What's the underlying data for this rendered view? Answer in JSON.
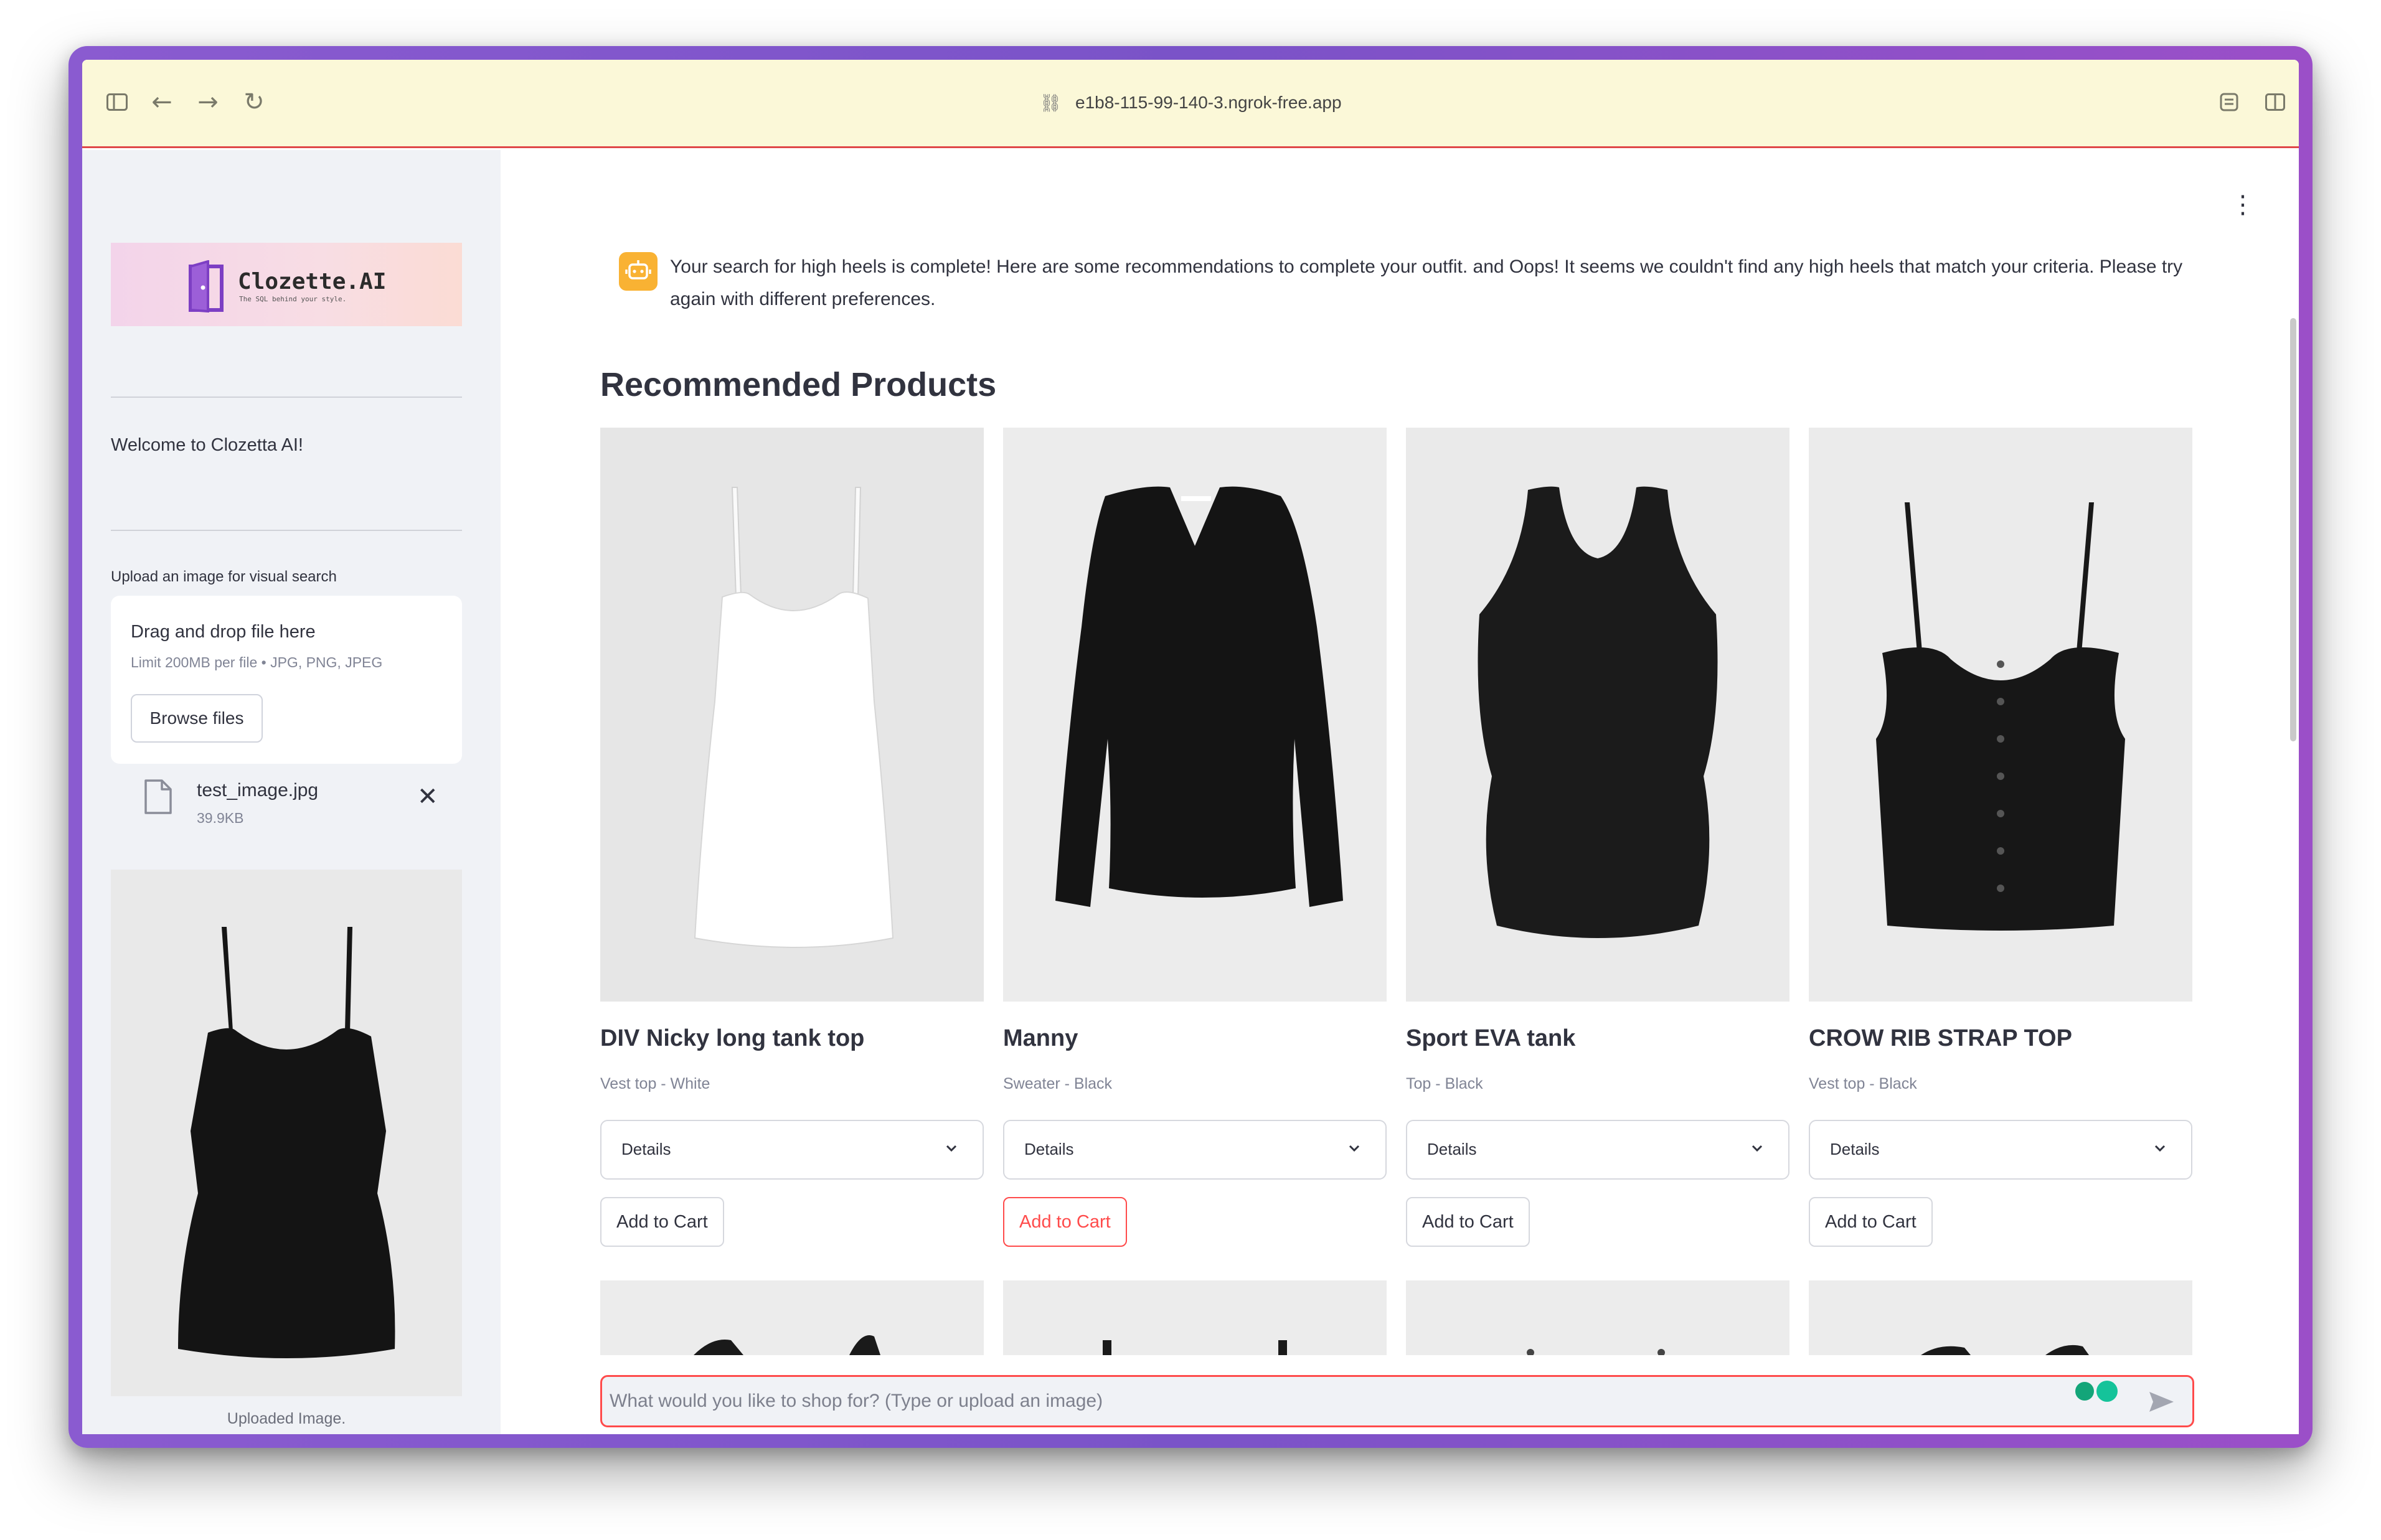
{
  "browser": {
    "url": "e1b8-115-99-140-3.ngrok-free.app"
  },
  "sidebar": {
    "logo_brand": "Clozette.AI",
    "logo_tagline": "The SQL behind your style.",
    "welcome": "Welcome to Clozetta AI!",
    "upload_label": "Upload an image for visual search",
    "dropzone_title": "Drag and drop file here",
    "dropzone_limit": "Limit 200MB per file • JPG, PNG, JPEG",
    "browse_label": "Browse files",
    "file_name": "test_image.jpg",
    "file_size": "39.9KB",
    "uploaded_caption": "Uploaded Image."
  },
  "main": {
    "assistant_message": "Your search for high heels is complete! Here are some recommendations to complete your outfit. and Oops! It seems we couldn't find any high heels that match your criteria. Please try again with different preferences.",
    "section_title": "Recommended Products",
    "details_label": "Details",
    "cart_label": "Add to Cart",
    "products": [
      {
        "name": "DIV Nicky long tank top",
        "subtitle": "Vest top - White",
        "garment_color": "#ffffff",
        "cart_active": false
      },
      {
        "name": "Manny",
        "subtitle": "Sweater - Black",
        "garment_color": "#151515",
        "cart_active": true
      },
      {
        "name": "Sport EVA tank",
        "subtitle": "Top - Black",
        "garment_color": "#1c1c1c",
        "cart_active": false
      },
      {
        "name": "CROW RIB STRAP TOP",
        "subtitle": "Vest top - Black",
        "garment_color": "#181818",
        "cart_active": false
      }
    ],
    "chat_placeholder": "What would you like to shop for? (Type or upload an image)"
  },
  "colors": {
    "accent": "#ff4b4b",
    "sidebar_bg": "#f0f2f6",
    "text": "#31333f",
    "assistant_avatar": "#f9b233"
  }
}
